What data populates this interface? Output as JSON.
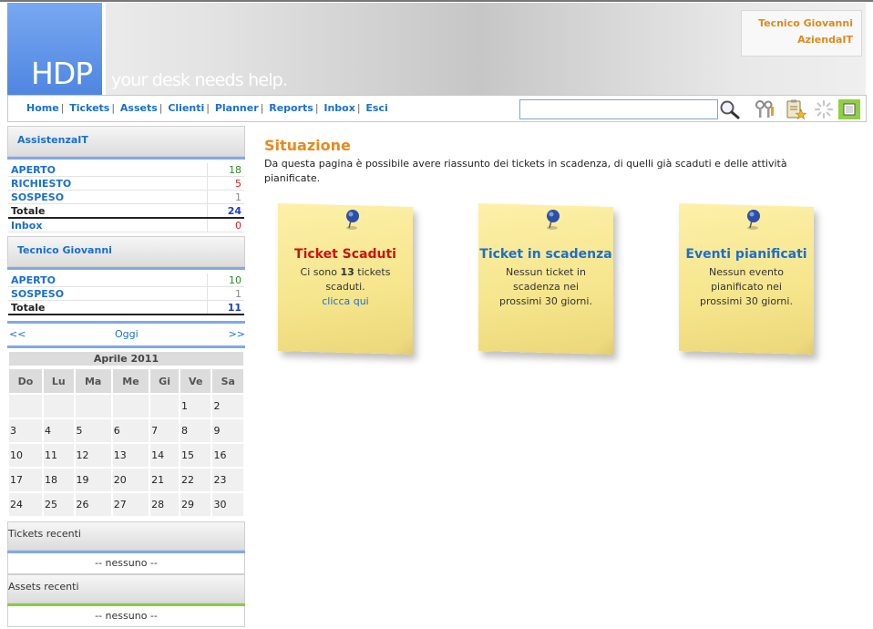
{
  "header": {
    "logo": "HDP",
    "tagline": "your desk needs help.",
    "user_name": "Tecnico Giovanni",
    "company": "AziendaIT"
  },
  "nav": {
    "items": [
      {
        "label": "Home"
      },
      {
        "label": "Tickets"
      },
      {
        "label": "Assets"
      },
      {
        "label": "Clienti"
      },
      {
        "label": "Planner"
      },
      {
        "label": "Reports"
      },
      {
        "label": "Inbox"
      },
      {
        "label": "Esci"
      }
    ],
    "separator": "|",
    "search_value": ""
  },
  "sidebar": {
    "group1": {
      "title": "AssistenzaIT",
      "rows": [
        {
          "label": "APERTO",
          "value": "18",
          "color": "#2a8a2a"
        },
        {
          "label": "RICHIESTO",
          "value": "5",
          "color": "#d02020"
        },
        {
          "label": "SOSPESO",
          "value": "1",
          "color": "#888888"
        }
      ],
      "total_label": "Totale",
      "total_value": "24",
      "inbox_label": "Inbox",
      "inbox_value": "0"
    },
    "group2": {
      "title": "Tecnico Giovanni",
      "rows": [
        {
          "label": "APERTO",
          "value": "10",
          "color": "#2a8a2a"
        },
        {
          "label": "SOSPESO",
          "value": "1",
          "color": "#888888"
        }
      ],
      "total_label": "Totale",
      "total_value": "11"
    },
    "calendar": {
      "prev": "<<",
      "today": "Oggi",
      "next": ">>",
      "month": "Aprile 2011",
      "days": [
        "Do",
        "Lu",
        "Ma",
        "Me",
        "Gi",
        "Ve",
        "Sa"
      ],
      "weeks": [
        [
          "",
          "",
          "",
          "",
          "",
          "1",
          "2"
        ],
        [
          "3",
          "4",
          "5",
          "6",
          "7",
          "8",
          "9"
        ],
        [
          "10",
          "11",
          "12",
          "13",
          "14",
          "15",
          "16"
        ],
        [
          "17",
          "18",
          "19",
          "20",
          "21",
          "22",
          "23"
        ],
        [
          "24",
          "25",
          "26",
          "27",
          "28",
          "29",
          "30"
        ]
      ]
    },
    "tickets_recent": {
      "title": "Tickets recenti",
      "empty": "-- nessuno --"
    },
    "assets_recent": {
      "title": "Assets recenti",
      "empty": "-- nessuno --"
    }
  },
  "main": {
    "title": "Situazione",
    "description": "Da questa pagina è possibile avere riassunto dei tickets in scadenza, di quelli già scaduti e delle attività pianificate.",
    "notes": [
      {
        "title": "Ticket Scaduti",
        "title_color": "#d01010",
        "line1_pre": "Ci sono",
        "line1_bold": "13",
        "line1_post": "tickets scaduti.",
        "link": "clicca qui"
      },
      {
        "title": "Ticket in scadenza",
        "title_color": "#1a6fd0",
        "body": "Nessun ticket in scadenza nei prossimi 30 giorni."
      },
      {
        "title": "Eventi pianificati",
        "title_color": "#1a6fd0",
        "body": "Nessun evento pianificato nei prossimi 30 giorni."
      }
    ]
  },
  "icons": {
    "search": "magnifier-icon",
    "tools": "tools-icon",
    "clipboard": "clipboard-star-icon",
    "loading": "spinner-icon",
    "toggle": "checkbox-toggle-icon"
  }
}
